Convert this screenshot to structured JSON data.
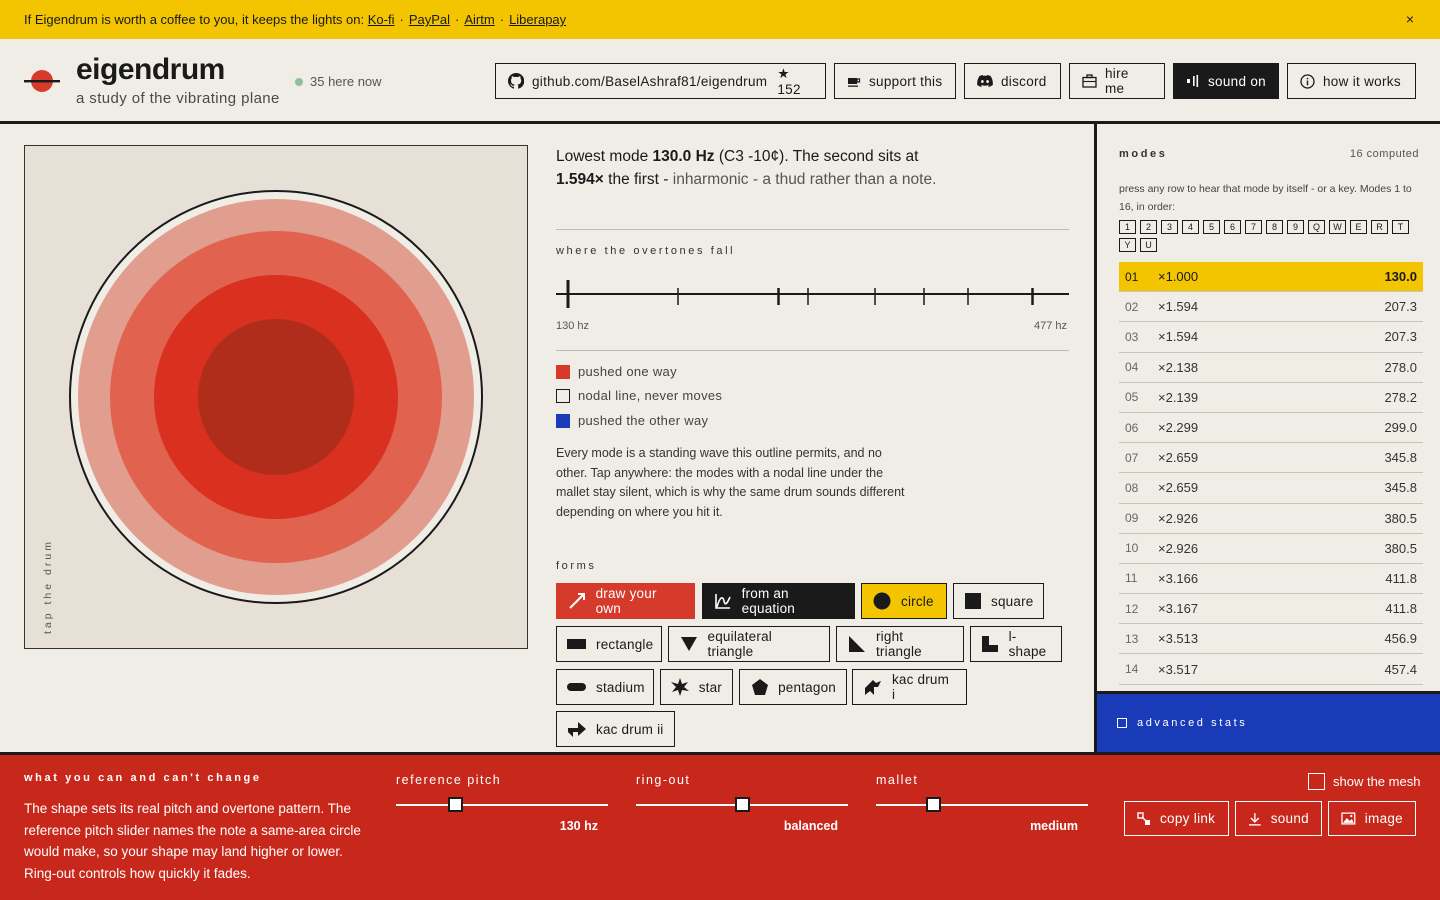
{
  "banner": {
    "text": "If Eigendrum is worth a coffee to you, it keeps the lights on:",
    "links": [
      "Ko-fi",
      "PayPal",
      "Airtm",
      "Liberapay"
    ],
    "close": "×"
  },
  "header": {
    "title": "eigendrum",
    "subtitle": "a study of the vibrating plane",
    "online": "35 here now",
    "github": "github.com/BaselAshraf81/eigendrum",
    "stars": "★ 152",
    "support": "support this",
    "discord": "discord",
    "hire": "hire me",
    "sound": "sound on",
    "how": "how it works"
  },
  "canvas": {
    "tap_label": "tap the drum"
  },
  "summary": {
    "p1": "Lowest mode ",
    "f1": "130.0 Hz",
    "p2": " (C3 -10¢). The second sits at ",
    "ratio": "1.594×",
    "p3": " the first - ",
    "p4": "inharmonic - a thud rather than a note."
  },
  "overtones": {
    "label": "where the overtones fall",
    "low": "130 hz",
    "high": "477 hz"
  },
  "legend": [
    "pushed one way",
    "nodal line, never moves",
    "pushed the other way"
  ],
  "colors": {
    "positive": "#d53a2a",
    "nodal": "#f0ede6",
    "negative": "#1a3bb8",
    "accent": "#f2c500"
  },
  "description": "Every mode is a standing wave this outline permits, and no other. Tap anywhere: the modes with a nodal line under the mallet stay silent, which is why the same drum sounds different depending on where you hit it.",
  "forms": {
    "label": "forms",
    "items": [
      "draw your own",
      "from an equation",
      "circle",
      "square",
      "rectangle",
      "equilateral triangle",
      "right triangle",
      "l-shape",
      "stadium",
      "star",
      "pentagon",
      "kac drum i",
      "kac drum ii"
    ]
  },
  "modes": {
    "title": "modes",
    "count": "16 computed",
    "hint": "press any row to hear that mode by itself - or a key. Modes 1 to 16, in order:",
    "keys": [
      "1",
      "2",
      "3",
      "4",
      "5",
      "6",
      "7",
      "8",
      "9",
      "Q",
      "W",
      "E",
      "R",
      "T",
      "Y",
      "U"
    ],
    "rows": [
      {
        "n": "01",
        "ratio": "×1.000",
        "hz": "130.0"
      },
      {
        "n": "02",
        "ratio": "×1.594",
        "hz": "207.3"
      },
      {
        "n": "03",
        "ratio": "×1.594",
        "hz": "207.3"
      },
      {
        "n": "04",
        "ratio": "×2.138",
        "hz": "278.0"
      },
      {
        "n": "05",
        "ratio": "×2.139",
        "hz": "278.2"
      },
      {
        "n": "06",
        "ratio": "×2.299",
        "hz": "299.0"
      },
      {
        "n": "07",
        "ratio": "×2.659",
        "hz": "345.8"
      },
      {
        "n": "08",
        "ratio": "×2.659",
        "hz": "345.8"
      },
      {
        "n": "09",
        "ratio": "×2.926",
        "hz": "380.5"
      },
      {
        "n": "10",
        "ratio": "×2.926",
        "hz": "380.5"
      },
      {
        "n": "11",
        "ratio": "×3.166",
        "hz": "411.8"
      },
      {
        "n": "12",
        "ratio": "×3.167",
        "hz": "411.8"
      },
      {
        "n": "13",
        "ratio": "×3.513",
        "hz": "456.9"
      },
      {
        "n": "14",
        "ratio": "×3.517",
        "hz": "457.4"
      }
    ],
    "advanced": "advanced stats"
  },
  "bottom": {
    "title": "what you can and can't change",
    "text": "The shape sets its real pitch and overtone pattern. The reference pitch slider names the note a same-area circle would make, so your shape may land higher or lower. Ring-out controls how quickly it fades.",
    "pitch_label": "reference pitch",
    "pitch_value": "130 hz",
    "pitch_level": 0.28,
    "ring_label": "ring-out",
    "ring_value": "balanced",
    "ring_level": 0.5,
    "mallet_label": "mallet",
    "mallet_value": "medium",
    "mallet_level": 0.27,
    "mesh": "show the mesh",
    "copy": "copy link",
    "sound": "sound",
    "image": "image"
  }
}
